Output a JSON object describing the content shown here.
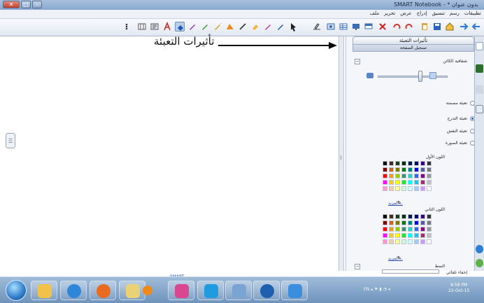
{
  "window": {
    "title": "بدون عنوان * - SMART Notebook",
    "controls": [
      "close",
      "maximize",
      "minimize"
    ]
  },
  "menu": [
    "ملف",
    "تحرير",
    "عرض",
    "إدراج",
    "تنسيق",
    "رسم",
    "تطبيقات"
  ],
  "toolbar_icons": [
    "back-icon",
    "forward-icon",
    "home-icon",
    "save-icon",
    "paste-icon",
    "undo-icon",
    "redo-icon",
    "delete-icon",
    "screen-shade-icon",
    "show-screen-icon",
    "table-icon",
    "capture-icon",
    "select-icon",
    "pen-icon",
    "creative-pen-icon",
    "eraser-icon",
    "line-icon",
    "shape-icon",
    "magic-pen-icon",
    "fill-icon",
    "text-icon",
    "properties-icon",
    "more-icon"
  ],
  "canvas": {
    "callout_text": "تأثيرات التعبئة",
    "footer_link": "SMART"
  },
  "panel": {
    "tab_fill": "تأثيرات التعبئة",
    "tab_record": "تسجيل الصفحة",
    "transparency_label": "شفافية الكائن",
    "fill_options": [
      {
        "label": "تعبئة مصمتة",
        "selected": false
      },
      {
        "label": "تعبئة التدرج",
        "selected": true
      },
      {
        "label": "تعبئة النقش",
        "selected": false
      },
      {
        "label": "تعبئة الصورة",
        "selected": false
      }
    ],
    "first_color_label": "اللون الأول",
    "second_color_label": "اللون الثاني",
    "more_label": "المزيد...",
    "style_label": "النمط",
    "auto_hide_label": "إخفاء تلقائي"
  },
  "palette_colors": [
    [
      "#000000",
      "#4d2a0f",
      "#1d3a1d",
      "#003300",
      "#001a4d",
      "#00007a",
      "#33007a",
      "#333333"
    ],
    [
      "#7a0000",
      "#e06000",
      "#7a7a00",
      "#008000",
      "#008080",
      "#0000ff",
      "#5a5a9a",
      "#7a7a7a"
    ],
    [
      "#ff0000",
      "#ff9900",
      "#99cc00",
      "#339966",
      "#33cccc",
      "#3366ff",
      "#800080",
      "#999999"
    ],
    [
      "#ff00ff",
      "#ffcc00",
      "#ffff00",
      "#00ff00",
      "#00ffff",
      "#00ccff",
      "#993366",
      "#c0c0c0"
    ],
    [
      "#ff99cc",
      "#ffcc99",
      "#ffff99",
      "#ccffcc",
      "#ccffff",
      "#99ccff",
      "#cc99ff",
      "#ffffff"
    ]
  ],
  "taskbar": {
    "apps": [
      "explorer",
      "internet-explorer",
      "firefox",
      "folder",
      "media-player",
      "paint",
      "skype",
      "notebook",
      "smart-meeting",
      "notebook-window"
    ],
    "tray_text": "EN",
    "time": "8:58 PM",
    "date": "22-Oct-15"
  }
}
